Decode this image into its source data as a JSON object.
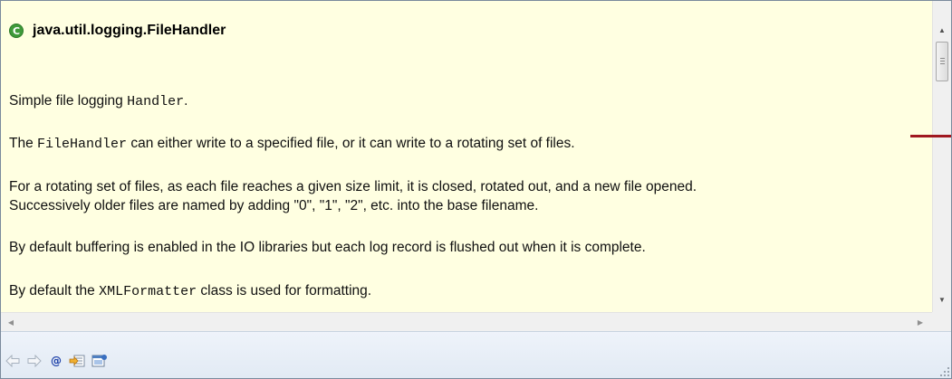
{
  "header": {
    "icon": "class-icon",
    "icon_letter": "C",
    "title": "java.util.logging.FileHandler"
  },
  "doc": {
    "p1": {
      "before": "Simple file logging ",
      "code": "Handler",
      "after": "."
    },
    "p2": {
      "before": "The ",
      "code": "FileHandler",
      "after": " can either write to a specified file, or it can write to a rotating set of files."
    },
    "p3_line1": "For a rotating set of files, as each file reaches a given size limit, it is closed, rotated out, and a new file opened.",
    "p3_line2": "Successively older files are named by adding \"0\", \"1\", \"2\", etc. into the base filename.",
    "p4": "By default buffering is enabled in the IO libraries but each log record is flushed out when it is complete.",
    "p5": {
      "before": "By default the ",
      "code": "XMLFormatter",
      "after": " class is used for formatting."
    }
  },
  "toolbar": {
    "buttons": [
      "back-icon",
      "forward-icon",
      "javadoc-at-icon",
      "open-declaration-icon",
      "open-attached-javadoc-icon"
    ],
    "at_label": "@"
  },
  "colors": {
    "background": "#ffffe1",
    "class_icon": "#3f9a3a",
    "red_mark": "#a01820"
  }
}
